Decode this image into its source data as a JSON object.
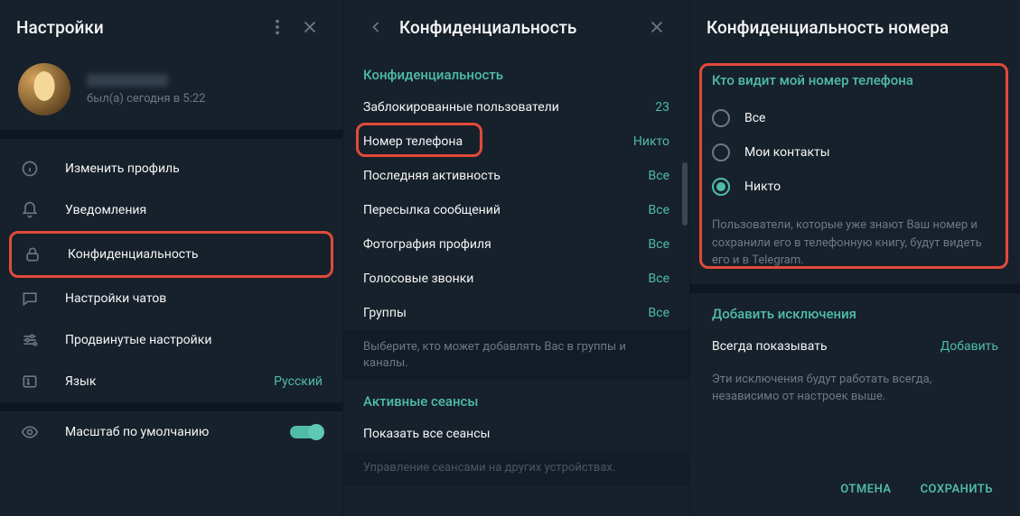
{
  "left": {
    "title": "Настройки",
    "status": "был(а) сегодня в 5:22",
    "menu": [
      {
        "label": "Изменить профиль"
      },
      {
        "label": "Уведомления"
      },
      {
        "label": "Конфиденциальность"
      },
      {
        "label": "Настройки чатов"
      },
      {
        "label": "Продвинутые настройки"
      },
      {
        "label": "Язык",
        "value": "Русский"
      }
    ],
    "zoom_label": "Масштаб по умолчанию"
  },
  "middle": {
    "title": "Конфиденциальность",
    "section1": "Конфиденциальность",
    "items": [
      {
        "label": "Заблокированные пользователи",
        "value": "23"
      },
      {
        "label": "Номер телефона",
        "value": "Никто"
      },
      {
        "label": "Последняя активность",
        "value": "Все"
      },
      {
        "label": "Пересылка сообщений",
        "value": "Все"
      },
      {
        "label": "Фотография профиля",
        "value": "Все"
      },
      {
        "label": "Голосовые звонки",
        "value": "Все"
      },
      {
        "label": "Группы",
        "value": "Все"
      }
    ],
    "hint1": "Выберите, кто может добавлять Вас в группы и каналы.",
    "section2": "Активные сеансы",
    "sessions_label": "Показать все сеансы",
    "hint2": "Управление сеансами на других устройствах."
  },
  "right": {
    "title": "Конфиденциальность номера",
    "section1": "Кто видит мой номер телефона",
    "options": [
      {
        "label": "Все"
      },
      {
        "label": "Мои контакты"
      },
      {
        "label": "Никто"
      }
    ],
    "help1": "Пользователи, которые уже знают Ваш номер и сохранили его в телефонную книгу, будут видеть его и в Telegram.",
    "section2": "Добавить исключения",
    "ex_label": "Всегда показывать",
    "ex_action": "Добавить",
    "help2": "Эти исключения будут работать всегда, независимо от настроек выше.",
    "cancel": "ОТМЕНА",
    "save": "СОХРАНИТЬ"
  }
}
